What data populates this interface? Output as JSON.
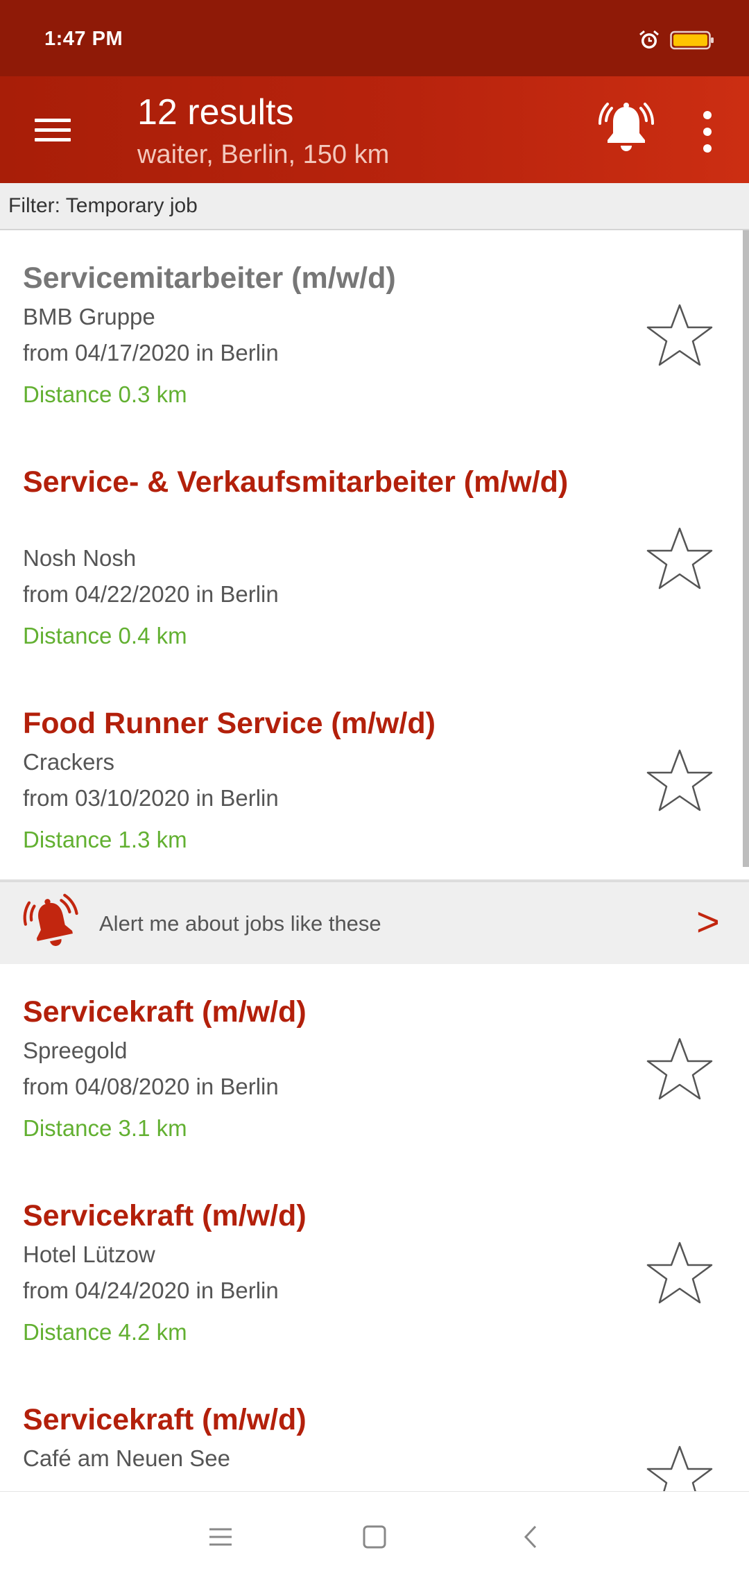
{
  "status_bar": {
    "time": "1:47 PM",
    "icons": [
      "alarm-icon",
      "battery-icon"
    ],
    "battery_color": "#ffc400"
  },
  "app_bar": {
    "title": "12 results",
    "subtitle": "waiter, Berlin, 150 km",
    "background": "#b8230d",
    "icons": [
      "menu-icon",
      "alert-bell-icon",
      "more-vert-icon"
    ]
  },
  "filter": {
    "label": "Filter: Temporary job"
  },
  "jobs": [
    {
      "title": "Servicemitarbeiter (m/w/d)",
      "company": "BMB Gruppe",
      "date": "from 04/17/2020 in Berlin",
      "distance": "Distance 0.3 km",
      "visited": true
    },
    {
      "title": "Service- & Verkaufsmitarbeiter (m/w/d)",
      "company": "Nosh Nosh",
      "date": "from 04/22/2020 in Berlin",
      "distance": "Distance 0.4 km",
      "visited": false
    },
    {
      "title": "Food Runner Service (m/w/d)",
      "company": "Crackers",
      "date": "from 03/10/2020 in Berlin",
      "distance": "Distance 1.3 km",
      "visited": false
    },
    {
      "title": "Servicekraft (m/w/d)",
      "company": "Spreegold",
      "date": "from 04/08/2020 in Berlin",
      "distance": "Distance 3.1 km",
      "visited": false
    },
    {
      "title": "Servicekraft (m/w/d)",
      "company": "Hotel Lützow",
      "date": "from 04/24/2020 in Berlin",
      "distance": "Distance 4.2 km",
      "visited": false
    },
    {
      "title": "Servicekraft (m/w/d)",
      "company": "Café am Neuen See",
      "date": "",
      "distance": "",
      "visited": false
    }
  ],
  "alert_row": {
    "label": "Alert me about jobs like these",
    "arrow": ">"
  },
  "colors": {
    "title_red": "#b3200b",
    "title_visited": "#777777",
    "distance_green": "#62b031"
  },
  "nav_bar": {
    "icons": [
      "recents-icon",
      "home-icon",
      "back-icon"
    ]
  }
}
